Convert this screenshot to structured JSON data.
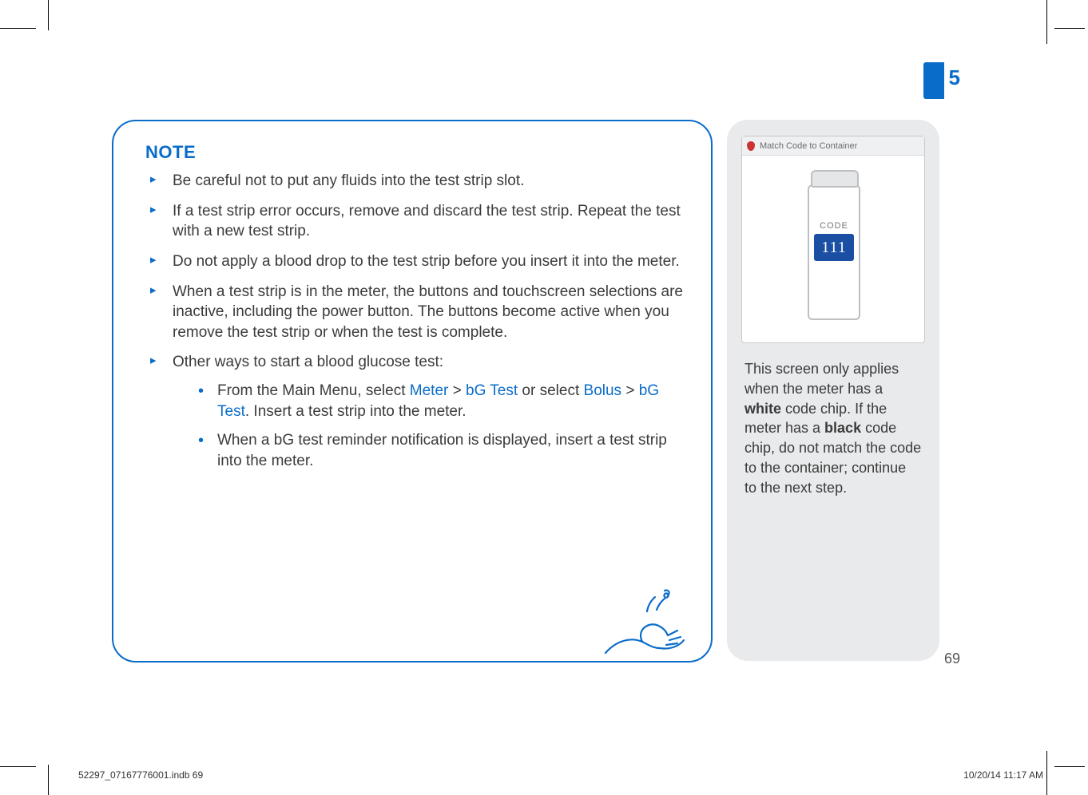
{
  "section_number": "5",
  "page_number": "69",
  "note": {
    "title": "NOTE",
    "items": {
      "i1": "Be careful not to put any fluids into the test strip slot.",
      "i2": "If a test strip error occurs, remove and discard the test strip. Repeat the test with a new test strip.",
      "i3": "Do not apply a blood drop to the test strip before you insert it into the meter.",
      "i4": "When a test strip is in the meter, the buttons and touchscreen selections are inactive, including the power button. The buttons become active when you remove the test strip or when the test is complete.",
      "i5": "Other ways to start a blood glucose test:"
    },
    "sub": {
      "s1_pre": "From the Main Menu, select ",
      "s1_m1": "Meter",
      "s1_gt1": " > ",
      "s1_m2": "bG Test",
      "s1_mid": " or select ",
      "s1_m3": "Bolus",
      "s1_gt2": " > ",
      "s1_m4": "bG Test",
      "s1_post": ". Insert a test strip into the meter.",
      "s2": "When a bG test reminder notification is displayed, insert a test strip into the meter."
    }
  },
  "side": {
    "header": "Match Code to Container",
    "code_label": "CODE",
    "code_value": "111",
    "text_pre": "This screen only applies when the meter has a ",
    "white": "white",
    "text_mid": " code chip. If the meter has a ",
    "black": "black",
    "text_post": " code chip, do not match the code to the container; continue to the next step."
  },
  "slug": "52297_07167776001.indb   69",
  "stamp": "10/20/14   11:17 AM"
}
